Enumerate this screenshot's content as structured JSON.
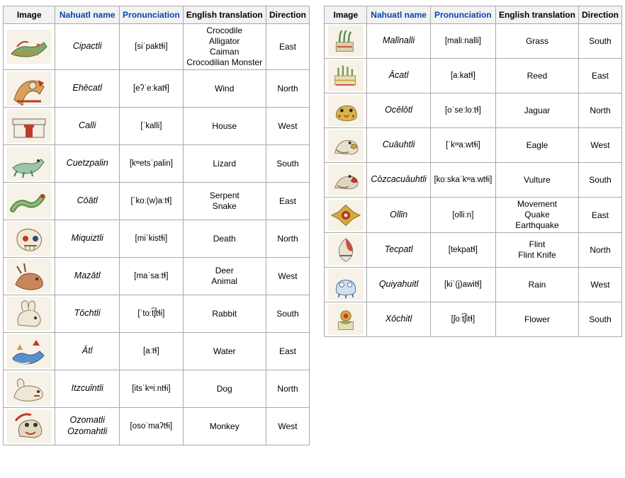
{
  "tables": [
    {
      "id": "table-1",
      "headers": [
        "Image",
        "Nahuatl name",
        "Pronunciation",
        "English translation",
        "Direction"
      ],
      "header_links": [
        false,
        true,
        true,
        false,
        false
      ],
      "rows": [
        {
          "glyph": "crocodile-glyph",
          "name": "Cipactli",
          "pron": "[siˈpaktɬi]",
          "translation": "Crocodile\nAlligator\nCaiman\nCrocodilian Monster",
          "direction": "East"
        },
        {
          "glyph": "wind-glyph",
          "name": "Ehēcatl",
          "pron": "[eʔˈeːkatɬ]",
          "translation": "Wind",
          "direction": "North"
        },
        {
          "glyph": "house-glyph",
          "name": "Calli",
          "pron": "[ˈkalli]",
          "translation": "House",
          "direction": "West"
        },
        {
          "glyph": "lizard-glyph",
          "name": "Cuetzpalin",
          "pron": "[kʷetsˈpalin]",
          "translation": "Lizard",
          "direction": "South"
        },
        {
          "glyph": "serpent-glyph",
          "name": "Cōātl",
          "pron": "[ˈkoː(w)aːtɬ]",
          "translation": "Serpent\nSnake",
          "direction": "East"
        },
        {
          "glyph": "death-glyph",
          "name": "Miquiztli",
          "pron": "[miˈkistɬi]",
          "translation": "Death",
          "direction": "North"
        },
        {
          "glyph": "deer-glyph",
          "name": "Mazātl",
          "pron": "[maˈsaːtɬ]",
          "translation": "Deer\nAnimal",
          "direction": "West"
        },
        {
          "glyph": "rabbit-glyph",
          "name": "Tōchtli",
          "pron": "[ˈtoːt͡ʃtɬi]",
          "translation": "Rabbit",
          "direction": "South"
        },
        {
          "glyph": "water-glyph",
          "name": "Ātl",
          "pron": "[aːtɬ]",
          "translation": "Water",
          "direction": "East"
        },
        {
          "glyph": "dog-glyph",
          "name": "Itzcuīntli",
          "pron": "[itsˈkʷiːntɬi]",
          "translation": "Dog",
          "direction": "North"
        },
        {
          "glyph": "monkey-glyph",
          "name": "Ozomatli\nOzomahtli",
          "pron": "[osoˈmaʔtɬi]",
          "translation": "Monkey",
          "direction": "West"
        }
      ]
    },
    {
      "id": "table-2",
      "headers": [
        "Image",
        "Nahuatl name",
        "Pronunciation",
        "English translation",
        "Direction"
      ],
      "header_links": [
        false,
        true,
        true,
        false,
        false
      ],
      "rows": [
        {
          "glyph": "grass-glyph",
          "name": "Malīnalli",
          "pron": "[maliːnalli]",
          "translation": "Grass",
          "direction": "South"
        },
        {
          "glyph": "reed-glyph",
          "name": "Ācatl",
          "pron": "[aːkatɬ]",
          "translation": "Reed",
          "direction": "East"
        },
        {
          "glyph": "jaguar-glyph",
          "name": "Ocēlōtl",
          "pron": "[oˈseːloːtɬ]",
          "translation": "Jaguar",
          "direction": "North"
        },
        {
          "glyph": "eagle-glyph",
          "name": "Cuāuhtli",
          "pron": "[ˈkʷaːwtɬi]",
          "translation": "Eagle",
          "direction": "West"
        },
        {
          "glyph": "vulture-glyph",
          "name": "Cōzcacuāuhtli",
          "pron": "[koːskaˈkʷaːwtɬi]",
          "translation": "Vulture",
          "direction": "South"
        },
        {
          "glyph": "movement-glyph",
          "name": "Ollīn",
          "pron": "[olliːn]",
          "translation": "Movement\nQuake\nEarthquake",
          "direction": "East"
        },
        {
          "glyph": "flint-glyph",
          "name": "Tecpatl",
          "pron": "[tekpatɬ]",
          "translation": "Flint\nFlint Knife",
          "direction": "North"
        },
        {
          "glyph": "rain-glyph",
          "name": "Quiyahuitl",
          "pron": "[kiˈ(j)awitɬ]",
          "translation": "Rain",
          "direction": "West"
        },
        {
          "glyph": "flower-glyph",
          "name": "Xōchitl",
          "pron": "[ʃoːt͡ʃitɬ]",
          "translation": "Flower",
          "direction": "South"
        }
      ]
    }
  ]
}
